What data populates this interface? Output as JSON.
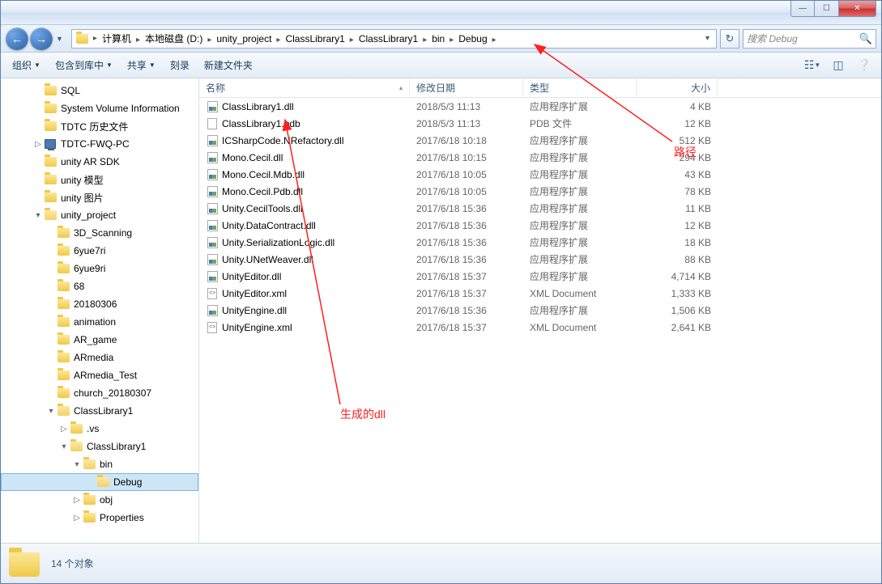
{
  "breadcrumb": {
    "segments": [
      "计算机",
      "本地磁盘 (D:)",
      "unity_project",
      "ClassLibrary1",
      "ClassLibrary1",
      "bin",
      "Debug"
    ]
  },
  "search": {
    "placeholder": "搜索 Debug"
  },
  "toolbar": {
    "organize": "组织",
    "include": "包含到库中",
    "share": "共享",
    "burn": "刻录",
    "newfolder": "新建文件夹"
  },
  "columns": {
    "name": "名称",
    "date": "修改日期",
    "type": "类型",
    "size": "大小"
  },
  "tree": [
    {
      "label": "SQL",
      "indent": 2,
      "icon": "folder",
      "exp": ""
    },
    {
      "label": "System Volume Information",
      "indent": 2,
      "icon": "folder",
      "exp": ""
    },
    {
      "label": "TDTC 历史文件",
      "indent": 2,
      "icon": "folder",
      "exp": ""
    },
    {
      "label": "TDTC-FWQ-PC",
      "indent": 2,
      "icon": "pc",
      "exp": "▷"
    },
    {
      "label": "unity AR SDK",
      "indent": 2,
      "icon": "folder",
      "exp": ""
    },
    {
      "label": "unity 模型",
      "indent": 2,
      "icon": "folder",
      "exp": ""
    },
    {
      "label": "unity 图片",
      "indent": 2,
      "icon": "folder",
      "exp": ""
    },
    {
      "label": "unity_project",
      "indent": 2,
      "icon": "folder-open",
      "exp": "▾"
    },
    {
      "label": "3D_Scanning",
      "indent": 3,
      "icon": "folder",
      "exp": ""
    },
    {
      "label": "6yue7ri",
      "indent": 3,
      "icon": "folder",
      "exp": ""
    },
    {
      "label": "6yue9ri",
      "indent": 3,
      "icon": "folder",
      "exp": ""
    },
    {
      "label": "68",
      "indent": 3,
      "icon": "folder",
      "exp": ""
    },
    {
      "label": "20180306",
      "indent": 3,
      "icon": "folder",
      "exp": ""
    },
    {
      "label": "animation",
      "indent": 3,
      "icon": "folder",
      "exp": ""
    },
    {
      "label": "AR_game",
      "indent": 3,
      "icon": "folder",
      "exp": ""
    },
    {
      "label": "ARmedia",
      "indent": 3,
      "icon": "folder",
      "exp": ""
    },
    {
      "label": "ARmedia_Test",
      "indent": 3,
      "icon": "folder",
      "exp": ""
    },
    {
      "label": "church_20180307",
      "indent": 3,
      "icon": "folder",
      "exp": ""
    },
    {
      "label": "ClassLibrary1",
      "indent": 3,
      "icon": "folder-open",
      "exp": "▾"
    },
    {
      "label": ".vs",
      "indent": 4,
      "icon": "folder",
      "exp": "▷"
    },
    {
      "label": "ClassLibrary1",
      "indent": 4,
      "icon": "folder-open",
      "exp": "▾"
    },
    {
      "label": "bin",
      "indent": 5,
      "icon": "folder-open",
      "exp": "▾"
    },
    {
      "label": "Debug",
      "indent": 6,
      "icon": "folder-open",
      "exp": "",
      "selected": true
    },
    {
      "label": "obj",
      "indent": 5,
      "icon": "folder",
      "exp": "▷"
    },
    {
      "label": "Properties",
      "indent": 5,
      "icon": "folder",
      "exp": "▷"
    }
  ],
  "files": [
    {
      "name": "ClassLibrary1.dll",
      "date": "2018/5/3 11:13",
      "type": "应用程序扩展",
      "size": "4 KB",
      "icon": "dll"
    },
    {
      "name": "ClassLibrary1.pdb",
      "date": "2018/5/3 11:13",
      "type": "PDB 文件",
      "size": "12 KB",
      "icon": "doc"
    },
    {
      "name": "ICSharpCode.NRefactory.dll",
      "date": "2017/6/18 10:18",
      "type": "应用程序扩展",
      "size": "512 KB",
      "icon": "dll"
    },
    {
      "name": "Mono.Cecil.dll",
      "date": "2017/6/18 10:15",
      "type": "应用程序扩展",
      "size": "294 KB",
      "icon": "dll"
    },
    {
      "name": "Mono.Cecil.Mdb.dll",
      "date": "2017/6/18 10:05",
      "type": "应用程序扩展",
      "size": "43 KB",
      "icon": "dll"
    },
    {
      "name": "Mono.Cecil.Pdb.dll",
      "date": "2017/6/18 10:05",
      "type": "应用程序扩展",
      "size": "78 KB",
      "icon": "dll"
    },
    {
      "name": "Unity.CecilTools.dll",
      "date": "2017/6/18 15:36",
      "type": "应用程序扩展",
      "size": "11 KB",
      "icon": "dll"
    },
    {
      "name": "Unity.DataContract.dll",
      "date": "2017/6/18 15:36",
      "type": "应用程序扩展",
      "size": "12 KB",
      "icon": "dll"
    },
    {
      "name": "Unity.SerializationLogic.dll",
      "date": "2017/6/18 15:36",
      "type": "应用程序扩展",
      "size": "18 KB",
      "icon": "dll"
    },
    {
      "name": "Unity.UNetWeaver.dll",
      "date": "2017/6/18 15:36",
      "type": "应用程序扩展",
      "size": "88 KB",
      "icon": "dll"
    },
    {
      "name": "UnityEditor.dll",
      "date": "2017/6/18 15:37",
      "type": "应用程序扩展",
      "size": "4,714 KB",
      "icon": "dll"
    },
    {
      "name": "UnityEditor.xml",
      "date": "2017/6/18 15:37",
      "type": "XML Document",
      "size": "1,333 KB",
      "icon": "xml"
    },
    {
      "name": "UnityEngine.dll",
      "date": "2017/6/18 15:36",
      "type": "应用程序扩展",
      "size": "1,506 KB",
      "icon": "dll"
    },
    {
      "name": "UnityEngine.xml",
      "date": "2017/6/18 15:37",
      "type": "XML Document",
      "size": "2,641 KB",
      "icon": "xml"
    }
  ],
  "status": {
    "count_text": "14 个对象"
  },
  "annotations": {
    "path_label": "路径",
    "dll_label": "生成的dll"
  }
}
